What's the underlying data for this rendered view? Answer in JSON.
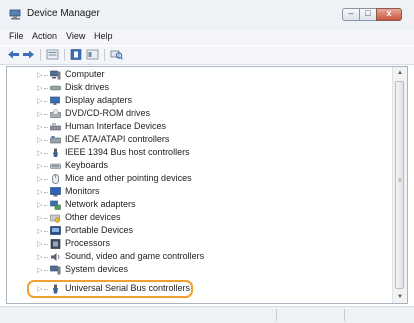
{
  "window": {
    "title": "Device Manager",
    "controls": {
      "minimize": "–",
      "maximize": "□",
      "close": "x"
    }
  },
  "menu": [
    "File",
    "Action",
    "View",
    "Help"
  ],
  "toolbar": [
    "back-icon",
    "forward-icon",
    "properties-icon",
    "help-icon",
    "view-icon",
    "scan-icon"
  ],
  "tree": {
    "items": [
      {
        "label": "Computer",
        "icon": "computer-icon"
      },
      {
        "label": "Disk drives",
        "icon": "disk-drive-icon"
      },
      {
        "label": "Display adapters",
        "icon": "display-adapter-icon"
      },
      {
        "label": "DVD/CD-ROM drives",
        "icon": "dvd-drive-icon"
      },
      {
        "label": "Human Interface Devices",
        "icon": "hid-icon"
      },
      {
        "label": "IDE ATA/ATAPI controllers",
        "icon": "ide-controller-icon"
      },
      {
        "label": "IEEE 1394 Bus host controllers",
        "icon": "ieee1394-icon"
      },
      {
        "label": "Keyboards",
        "icon": "keyboard-icon"
      },
      {
        "label": "Mice and other pointing devices",
        "icon": "mouse-icon"
      },
      {
        "label": "Monitors",
        "icon": "monitor-icon"
      },
      {
        "label": "Network adapters",
        "icon": "network-adapter-icon"
      },
      {
        "label": "Other devices",
        "icon": "other-devices-icon"
      },
      {
        "label": "Portable Devices",
        "icon": "portable-device-icon"
      },
      {
        "label": "Processors",
        "icon": "processor-icon"
      },
      {
        "label": "Sound, video and game controllers",
        "icon": "sound-icon"
      },
      {
        "label": "System devices",
        "icon": "system-device-icon"
      },
      {
        "label": "Universal Serial Bus controllers",
        "icon": "usb-icon"
      }
    ],
    "highlighted_item": "Universal Serial Bus controllers"
  },
  "colors": {
    "highlight": "#f0a030",
    "close_button": "#c8553b"
  }
}
